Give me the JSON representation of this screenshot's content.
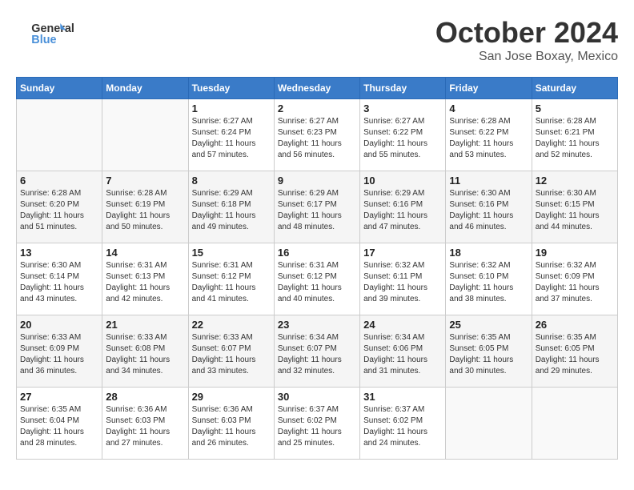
{
  "header": {
    "logo_general": "General",
    "logo_blue": "Blue",
    "month_title": "October 2024",
    "location": "San Jose Boxay, Mexico"
  },
  "days_of_week": [
    "Sunday",
    "Monday",
    "Tuesday",
    "Wednesday",
    "Thursday",
    "Friday",
    "Saturday"
  ],
  "weeks": [
    [
      {
        "day": "",
        "sunrise": "",
        "sunset": "",
        "daylight": ""
      },
      {
        "day": "",
        "sunrise": "",
        "sunset": "",
        "daylight": ""
      },
      {
        "day": "1",
        "sunrise": "Sunrise: 6:27 AM",
        "sunset": "Sunset: 6:24 PM",
        "daylight": "Daylight: 11 hours and 57 minutes."
      },
      {
        "day": "2",
        "sunrise": "Sunrise: 6:27 AM",
        "sunset": "Sunset: 6:23 PM",
        "daylight": "Daylight: 11 hours and 56 minutes."
      },
      {
        "day": "3",
        "sunrise": "Sunrise: 6:27 AM",
        "sunset": "Sunset: 6:22 PM",
        "daylight": "Daylight: 11 hours and 55 minutes."
      },
      {
        "day": "4",
        "sunrise": "Sunrise: 6:28 AM",
        "sunset": "Sunset: 6:22 PM",
        "daylight": "Daylight: 11 hours and 53 minutes."
      },
      {
        "day": "5",
        "sunrise": "Sunrise: 6:28 AM",
        "sunset": "Sunset: 6:21 PM",
        "daylight": "Daylight: 11 hours and 52 minutes."
      }
    ],
    [
      {
        "day": "6",
        "sunrise": "Sunrise: 6:28 AM",
        "sunset": "Sunset: 6:20 PM",
        "daylight": "Daylight: 11 hours and 51 minutes."
      },
      {
        "day": "7",
        "sunrise": "Sunrise: 6:28 AM",
        "sunset": "Sunset: 6:19 PM",
        "daylight": "Daylight: 11 hours and 50 minutes."
      },
      {
        "day": "8",
        "sunrise": "Sunrise: 6:29 AM",
        "sunset": "Sunset: 6:18 PM",
        "daylight": "Daylight: 11 hours and 49 minutes."
      },
      {
        "day": "9",
        "sunrise": "Sunrise: 6:29 AM",
        "sunset": "Sunset: 6:17 PM",
        "daylight": "Daylight: 11 hours and 48 minutes."
      },
      {
        "day": "10",
        "sunrise": "Sunrise: 6:29 AM",
        "sunset": "Sunset: 6:16 PM",
        "daylight": "Daylight: 11 hours and 47 minutes."
      },
      {
        "day": "11",
        "sunrise": "Sunrise: 6:30 AM",
        "sunset": "Sunset: 6:16 PM",
        "daylight": "Daylight: 11 hours and 46 minutes."
      },
      {
        "day": "12",
        "sunrise": "Sunrise: 6:30 AM",
        "sunset": "Sunset: 6:15 PM",
        "daylight": "Daylight: 11 hours and 44 minutes."
      }
    ],
    [
      {
        "day": "13",
        "sunrise": "Sunrise: 6:30 AM",
        "sunset": "Sunset: 6:14 PM",
        "daylight": "Daylight: 11 hours and 43 minutes."
      },
      {
        "day": "14",
        "sunrise": "Sunrise: 6:31 AM",
        "sunset": "Sunset: 6:13 PM",
        "daylight": "Daylight: 11 hours and 42 minutes."
      },
      {
        "day": "15",
        "sunrise": "Sunrise: 6:31 AM",
        "sunset": "Sunset: 6:12 PM",
        "daylight": "Daylight: 11 hours and 41 minutes."
      },
      {
        "day": "16",
        "sunrise": "Sunrise: 6:31 AM",
        "sunset": "Sunset: 6:12 PM",
        "daylight": "Daylight: 11 hours and 40 minutes."
      },
      {
        "day": "17",
        "sunrise": "Sunrise: 6:32 AM",
        "sunset": "Sunset: 6:11 PM",
        "daylight": "Daylight: 11 hours and 39 minutes."
      },
      {
        "day": "18",
        "sunrise": "Sunrise: 6:32 AM",
        "sunset": "Sunset: 6:10 PM",
        "daylight": "Daylight: 11 hours and 38 minutes."
      },
      {
        "day": "19",
        "sunrise": "Sunrise: 6:32 AM",
        "sunset": "Sunset: 6:09 PM",
        "daylight": "Daylight: 11 hours and 37 minutes."
      }
    ],
    [
      {
        "day": "20",
        "sunrise": "Sunrise: 6:33 AM",
        "sunset": "Sunset: 6:09 PM",
        "daylight": "Daylight: 11 hours and 36 minutes."
      },
      {
        "day": "21",
        "sunrise": "Sunrise: 6:33 AM",
        "sunset": "Sunset: 6:08 PM",
        "daylight": "Daylight: 11 hours and 34 minutes."
      },
      {
        "day": "22",
        "sunrise": "Sunrise: 6:33 AM",
        "sunset": "Sunset: 6:07 PM",
        "daylight": "Daylight: 11 hours and 33 minutes."
      },
      {
        "day": "23",
        "sunrise": "Sunrise: 6:34 AM",
        "sunset": "Sunset: 6:07 PM",
        "daylight": "Daylight: 11 hours and 32 minutes."
      },
      {
        "day": "24",
        "sunrise": "Sunrise: 6:34 AM",
        "sunset": "Sunset: 6:06 PM",
        "daylight": "Daylight: 11 hours and 31 minutes."
      },
      {
        "day": "25",
        "sunrise": "Sunrise: 6:35 AM",
        "sunset": "Sunset: 6:05 PM",
        "daylight": "Daylight: 11 hours and 30 minutes."
      },
      {
        "day": "26",
        "sunrise": "Sunrise: 6:35 AM",
        "sunset": "Sunset: 6:05 PM",
        "daylight": "Daylight: 11 hours and 29 minutes."
      }
    ],
    [
      {
        "day": "27",
        "sunrise": "Sunrise: 6:35 AM",
        "sunset": "Sunset: 6:04 PM",
        "daylight": "Daylight: 11 hours and 28 minutes."
      },
      {
        "day": "28",
        "sunrise": "Sunrise: 6:36 AM",
        "sunset": "Sunset: 6:03 PM",
        "daylight": "Daylight: 11 hours and 27 minutes."
      },
      {
        "day": "29",
        "sunrise": "Sunrise: 6:36 AM",
        "sunset": "Sunset: 6:03 PM",
        "daylight": "Daylight: 11 hours and 26 minutes."
      },
      {
        "day": "30",
        "sunrise": "Sunrise: 6:37 AM",
        "sunset": "Sunset: 6:02 PM",
        "daylight": "Daylight: 11 hours and 25 minutes."
      },
      {
        "day": "31",
        "sunrise": "Sunrise: 6:37 AM",
        "sunset": "Sunset: 6:02 PM",
        "daylight": "Daylight: 11 hours and 24 minutes."
      },
      {
        "day": "",
        "sunrise": "",
        "sunset": "",
        "daylight": ""
      },
      {
        "day": "",
        "sunrise": "",
        "sunset": "",
        "daylight": ""
      }
    ]
  ]
}
